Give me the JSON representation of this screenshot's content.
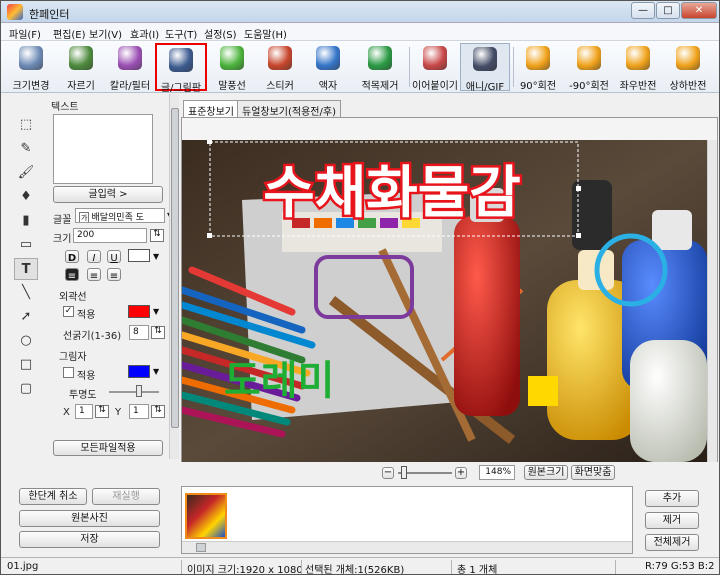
{
  "window": {
    "title": "한페인터"
  },
  "menu": [
    "파일(F)",
    "편집(E)",
    "보기(V)",
    "효과(I)",
    "도구(T)",
    "설정(S)",
    "도움말(H)"
  ],
  "toolbar": [
    {
      "label": "크기변경",
      "icon": "resize-icon",
      "color": "#6c8ab5"
    },
    {
      "label": "자르기",
      "icon": "crop-icon",
      "color": "#4d8a3c"
    },
    {
      "label": "칼라/필터",
      "icon": "filter-icon",
      "color": "#9b4fb4"
    },
    {
      "label": "글/그림판",
      "icon": "text-board-icon",
      "color": "#3b5a8f"
    },
    {
      "label": "말풍선",
      "icon": "speech-bubble-icon",
      "color": "#4bb33b"
    },
    {
      "label": "스티커",
      "icon": "sticker-icon",
      "color": "#c7452c"
    },
    {
      "label": "액자",
      "icon": "frame-icon",
      "color": "#3575c8"
    },
    {
      "label": "적목제거",
      "icon": "red-eye-icon",
      "color": "#2a9a44"
    },
    {
      "label": "이어붙이기",
      "icon": "merge-icon",
      "color": "#c84747"
    },
    {
      "label": "애니/GIF",
      "icon": "gif-icon",
      "color": "#444c66"
    },
    {
      "label": "90°회전",
      "icon": "rotate-cw-icon",
      "color": "#f0a21a"
    },
    {
      "label": "-90°회전",
      "icon": "rotate-ccw-icon",
      "color": "#f0a21a"
    },
    {
      "label": "좌우반전",
      "icon": "flip-h-icon",
      "color": "#f0a21a"
    },
    {
      "label": "상하반전",
      "icon": "flip-v-icon",
      "color": "#f0a21a"
    }
  ],
  "panel": {
    "text_label": "텍스트",
    "text_input_button": "글입력 >",
    "font_label": "글꼴",
    "font_value": "배달의민족 도",
    "size_label": "크기",
    "size_value": "200",
    "style_buttons": [
      "D",
      "I",
      "U"
    ],
    "align_buttons": [
      "≡",
      "≡",
      "≡"
    ],
    "outline_label": "외곽선",
    "outline_apply": "적용",
    "outline_apply_checked": true,
    "outline_color": "#ff0000",
    "thickness_label": "선굵기(1-36)",
    "thickness_value": "8",
    "shadow_label": "그림자",
    "shadow_apply": "적용",
    "shadow_apply_checked": false,
    "shadow_color": "#0000ff",
    "opacity_label": "투명도",
    "x_label": "X",
    "x_value": "1",
    "y_label": "Y",
    "y_value": "1",
    "apply_all_button": "모든파일적용",
    "font_icon_text": "가",
    "text_color": "#ffffff"
  },
  "bottom_left": {
    "undo": "한단계 취소",
    "redo": "재실행",
    "original": "원본사진",
    "save": "저장"
  },
  "tabs": [
    "표준창보기",
    "듀얼창보기(적용전/후)"
  ],
  "canvas": {
    "title_text": "수채화물감",
    "title_color": "#ffffff",
    "title_outline": "#e8141c",
    "sub_text": "도레미",
    "sub_color": "#1fae34",
    "square_color": "#ffd800",
    "circle_color": "#2bb0e6",
    "rect_color": "#7b3a9c"
  },
  "zoom": {
    "value": "148%",
    "fit_original": "원본크기",
    "fit_screen": "화면맞춤",
    "minus": "−",
    "plus": "+"
  },
  "right_buttons": {
    "add": "추가",
    "remove": "제거",
    "remove_all": "전체제거"
  },
  "status": {
    "file": "01.jpg",
    "image_size": "이미지 크기:1920 x 1080",
    "selected": "선택된 개체:1(526KB)",
    "total": "총 1 개체",
    "rgb": "R:79 G:53 B:2"
  }
}
